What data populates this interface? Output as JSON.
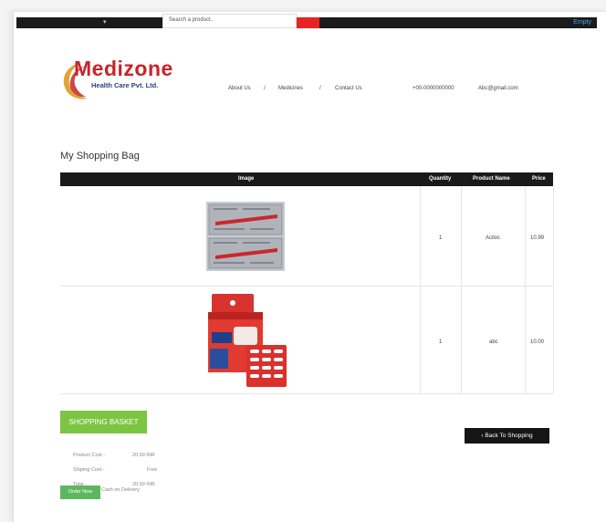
{
  "topbar": {
    "search_placeholder": "Search a product..",
    "cart_status": "Empty"
  },
  "brand": {
    "name": "Medizone",
    "tagline": "Health Care Pvt. Ltd."
  },
  "nav": {
    "about": "About Us",
    "sep1": "/",
    "medicines": "Medicines",
    "sep2": "/",
    "contact": "Contact Us",
    "phone": "+00-0000000000",
    "email": "Abc@gmail.com"
  },
  "page_title": "My Shopping Bag",
  "table": {
    "headers": [
      "Image",
      "Quantity",
      "Product Name",
      "Price"
    ],
    "rows": [
      {
        "quantity": "1",
        "product": "Aciloc",
        "price": "10.99"
      },
      {
        "quantity": "1",
        "product": "abc",
        "price": "10.00"
      }
    ]
  },
  "summary": {
    "basket_label": "SHOPPING BASKET",
    "product_cost_label": "Product Cost -",
    "product_cost_value": "20.99 INR",
    "shipping_cost_label": "Shiping Cost -",
    "shipping_cost_value": "Free",
    "total_label": "Total -",
    "total_value": "20.99 INR",
    "order_button": "Order Now",
    "payment_method": "Cash on Delivery"
  },
  "back_button": "Back To Shopping",
  "colors": {
    "brand_red": "#c6252a",
    "brand_blue": "#2a3e7c",
    "basket_green": "#7cc542",
    "topbar": "#1b1b1b",
    "search_button": "#e82323"
  }
}
